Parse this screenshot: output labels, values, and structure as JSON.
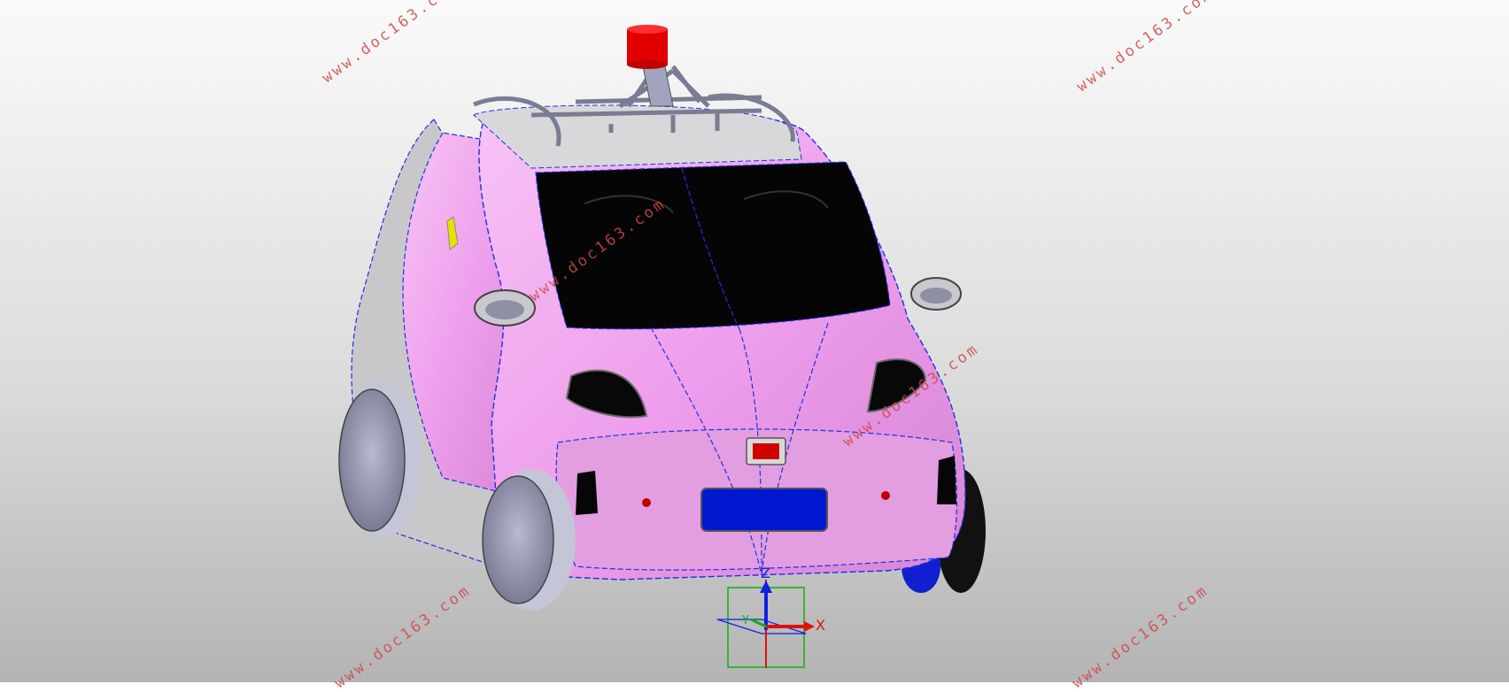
{
  "viewport": {
    "name": "3D model viewport",
    "background_top": "#fafafa",
    "background_bottom": "#b4b4b4"
  },
  "model": {
    "body_color": "#f0a8ee",
    "trim_color": "#d6d6d6",
    "window_color": "#000000",
    "edge_color": "#2030e0",
    "plate_color": "#0018d0",
    "beacon_color": "#e00000",
    "rack_color": "#b0b4c8",
    "wheel_color": "#9a9cb8",
    "side_marker_color": "#e8e000"
  },
  "watermarks": [
    "www.doc163.com",
    "www.doc163.com",
    "www.doc163.com",
    "www.doc163.com",
    "www.doc163.com",
    "www.doc163.com"
  ],
  "triad": {
    "x_label": "X",
    "y_label": "Y",
    "z_label": "Z",
    "x_color": "#e01010",
    "y_color": "#10b010",
    "z_color": "#1020e0"
  }
}
